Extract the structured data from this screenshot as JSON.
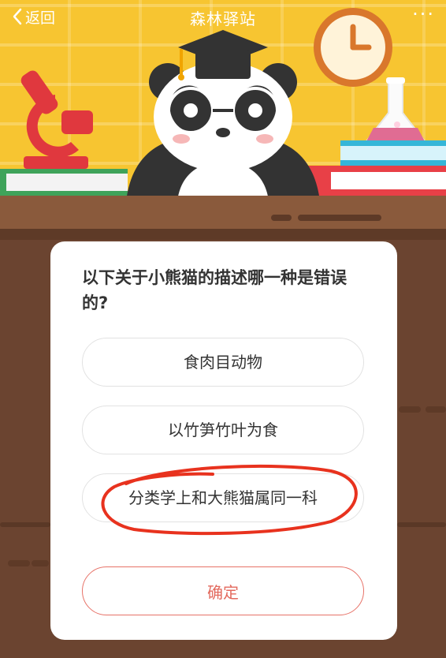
{
  "nav": {
    "back_label": "返回",
    "title": "森林驿站",
    "more_icon": "more-dots-icon"
  },
  "quiz": {
    "question": "以下关于小熊猫的描述哪一种是错误的?",
    "options": [
      {
        "label": "食肉目动物"
      },
      {
        "label": "以竹笋竹叶为食"
      },
      {
        "label": "分类学上和大熊猫属同一科"
      }
    ],
    "confirm_label": "确定"
  },
  "colors": {
    "background_yellow": "#f7c531",
    "desk_brown": "#6b4430",
    "accent_red": "#e36a5e",
    "annotation_red": "#e8321e"
  }
}
